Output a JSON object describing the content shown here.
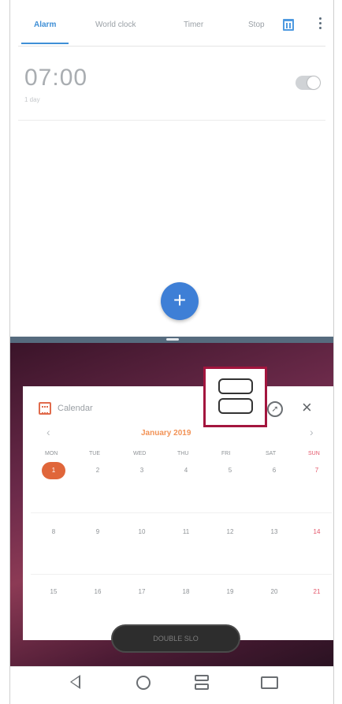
{
  "clock": {
    "tabs": [
      "Alarm",
      "World clock",
      "Timer",
      "Stop"
    ],
    "alarm": {
      "time": "07:00",
      "sub": "1 day",
      "enabled": false
    }
  },
  "fab": {
    "icon": "plus-icon",
    "label": "+"
  },
  "calendar": {
    "title": "Calendar",
    "month": "January 2019",
    "weekdays": [
      "MON",
      "TUE",
      "WED",
      "THU",
      "FRI",
      "SAT",
      "SUN"
    ],
    "weeks": [
      [
        "1",
        "2",
        "3",
        "4",
        "5",
        "6",
        "7"
      ],
      [
        "8",
        "9",
        "10",
        "11",
        "12",
        "13",
        "14"
      ],
      [
        "15",
        "16",
        "17",
        "18",
        "19",
        "20",
        "21"
      ]
    ],
    "pin_icon": "pin-icon",
    "close_icon": "close-icon",
    "close_label": "×",
    "prev_label": "‹",
    "next_label": "›",
    "bottom_pill": "DOUBLE SLO"
  },
  "highlight": {
    "icon": "split-screen-icon",
    "color": "#a3153e"
  },
  "navbar": {
    "back_icon": "back-icon",
    "home_icon": "home-icon",
    "split_icon": "split-screen-icon",
    "multi_icon": "dual-window-icon"
  },
  "colors": {
    "accent": "#3f8fd6",
    "today": "#e0663a",
    "sunday": "#e4566a",
    "highlight": "#a3153e"
  }
}
